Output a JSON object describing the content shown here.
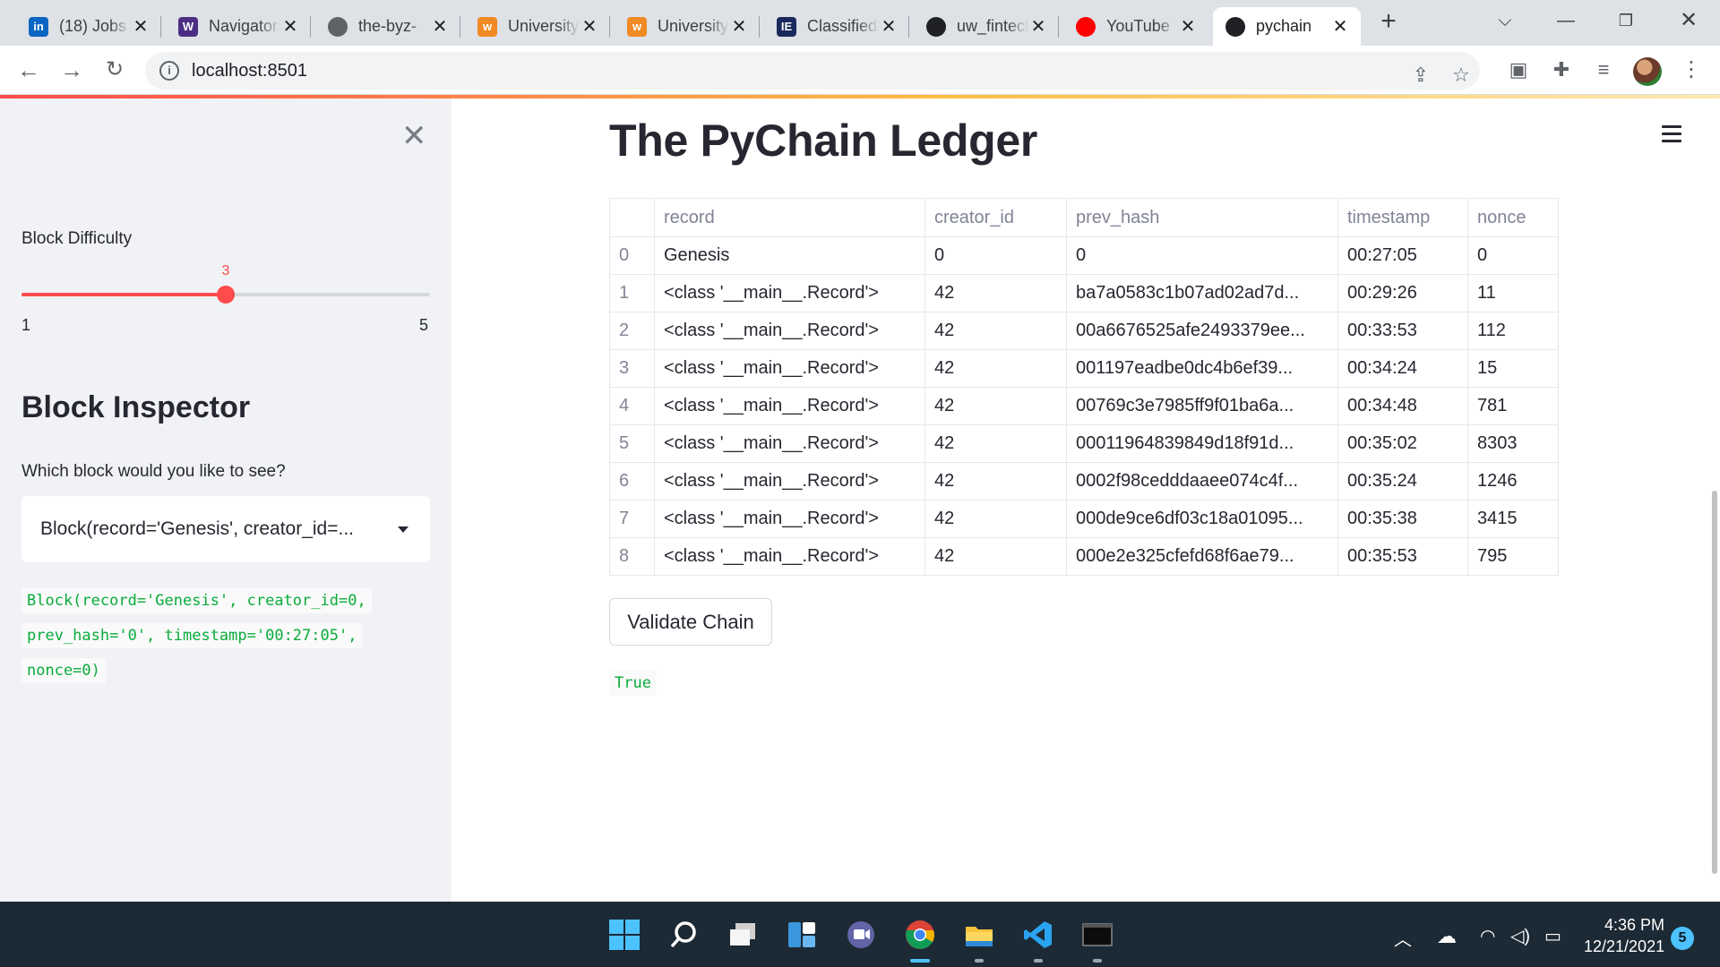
{
  "browser": {
    "tabs": [
      {
        "title": "(18) Jobs",
        "icon": "linkedin-icon",
        "color": "#0a66c2",
        "glyph": "in"
      },
      {
        "title": "Navigator",
        "icon": "uw-logo-icon",
        "color": "#4b2e83",
        "glyph": "W"
      },
      {
        "title": "the-byz-",
        "icon": "globe-icon",
        "color": "#5f6368",
        "glyph": ""
      },
      {
        "title": "University",
        "icon": "uw-orange-logo-icon",
        "color": "#f08a24",
        "glyph": "w"
      },
      {
        "title": "University",
        "icon": "uw-orange-logo-icon",
        "color": "#f08a24",
        "glyph": "w"
      },
      {
        "title": "Classified",
        "icon": "classified-icon",
        "color": "#1a2a5c",
        "glyph": "IE"
      },
      {
        "title": "uw_fintech",
        "icon": "github-icon",
        "color": "#202124",
        "glyph": ""
      },
      {
        "title": "YouTube",
        "icon": "youtube-icon",
        "color": "#ff0000",
        "glyph": ""
      },
      {
        "title": "pychain",
        "icon": "streamlit-icon",
        "color": "#202124",
        "glyph": ""
      }
    ],
    "url": "localhost:8501"
  },
  "sidebar": {
    "difficulty_label": "Block Difficulty",
    "difficulty_value": "3",
    "difficulty_min": "1",
    "difficulty_max": "5",
    "difficulty_fraction": 0.5,
    "inspector_title": "Block Inspector",
    "select_label": "Which block would you like to see?",
    "select_value": "Block(record='Genesis', creator_id=...",
    "code_lines": [
      "Block(record='Genesis', creator_id=0,",
      "prev_hash='0', timestamp='00:27:05',",
      "nonce=0)"
    ]
  },
  "main": {
    "title": "The PyChain Ledger",
    "columns": [
      "",
      "record",
      "creator_id",
      "prev_hash",
      "timestamp",
      "nonce"
    ],
    "rows": [
      [
        "0",
        "Genesis",
        "0",
        "0",
        "00:27:05",
        "0"
      ],
      [
        "1",
        "<class '__main__.Record'>",
        "42",
        "ba7a0583c1b07ad02ad7d...",
        "00:29:26",
        "11"
      ],
      [
        "2",
        "<class '__main__.Record'>",
        "42",
        "00a6676525afe2493379ee...",
        "00:33:53",
        "112"
      ],
      [
        "3",
        "<class '__main__.Record'>",
        "42",
        "001197eadbe0dc4b6ef39...",
        "00:34:24",
        "15"
      ],
      [
        "4",
        "<class '__main__.Record'>",
        "42",
        "00769c3e7985ff9f01ba6a...",
        "00:34:48",
        "781"
      ],
      [
        "5",
        "<class '__main__.Record'>",
        "42",
        "00011964839849d18f91d...",
        "00:35:02",
        "8303"
      ],
      [
        "6",
        "<class '__main__.Record'>",
        "42",
        "0002f98cedddaaee074c4f...",
        "00:35:24",
        "1246"
      ],
      [
        "7",
        "<class '__main__.Record'>",
        "42",
        "000de9ce6df03c18a01095...",
        "00:35:38",
        "3415"
      ],
      [
        "8",
        "<class '__main__.Record'>",
        "42",
        "000e2e325cfefd68f6ae79...",
        "00:35:53",
        "795"
      ]
    ],
    "validate_label": "Validate Chain",
    "validate_result": "True"
  },
  "taskbar": {
    "time": "4:36 PM",
    "date": "12/21/2021",
    "notifications": "5"
  },
  "colors": {
    "accent": "#ff4b4b",
    "code_green": "#09ab3b",
    "sidebar_bg": "#f0f2f6"
  }
}
